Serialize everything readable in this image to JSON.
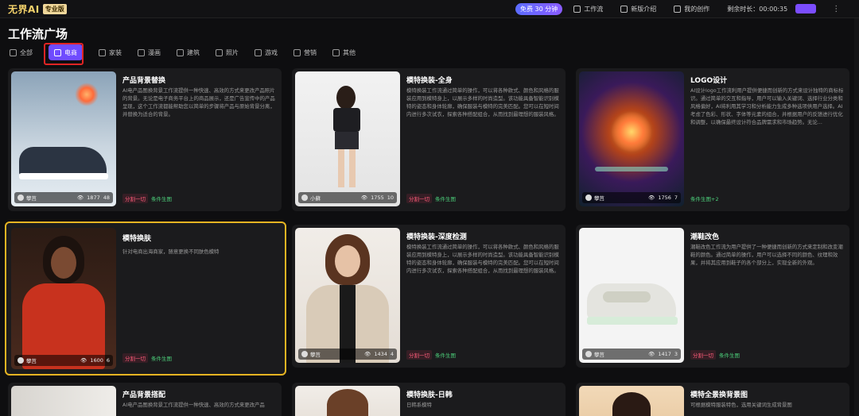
{
  "topbar": {
    "logo": "无界AI",
    "edition": "专业版",
    "free_pill": "免费 30 分钟",
    "nav": [
      {
        "label": "工作流",
        "icon": "workflow-icon"
      },
      {
        "label": "新版介绍",
        "icon": "intro-icon"
      },
      {
        "label": "我的创作",
        "icon": "gallery-icon"
      }
    ],
    "timer": "剩余时长：00:00:35"
  },
  "page": {
    "title": "工作流广场"
  },
  "tabs": [
    {
      "label": "全部",
      "icon": "grid-icon",
      "active": false
    },
    {
      "label": "电商",
      "icon": "shop-icon",
      "active": true
    },
    {
      "label": "家装",
      "icon": "sofa-icon",
      "active": false
    },
    {
      "label": "漫画",
      "icon": "comic-icon",
      "active": false
    },
    {
      "label": "建筑",
      "icon": "building-icon",
      "active": false
    },
    {
      "label": "照片",
      "icon": "camera-icon",
      "active": false
    },
    {
      "label": "游戏",
      "icon": "gamepad-icon",
      "active": false
    },
    {
      "label": "营销",
      "icon": "target-icon",
      "active": false
    },
    {
      "label": "其他",
      "icon": "more-icon",
      "active": false
    }
  ],
  "cards": [
    {
      "title": "产品背景替换",
      "desc": "AI电产品图换背景工作流提供一种快速、高效的方式来更改产品照片的背景。无论是电子商务平台上的商品展示，还是广告宣传中的产品呈现，这个工作流都能帮助您以简单的步骤将产品与原始背景分离，并替换为适合的背景。",
      "author": "攀莒",
      "views": "1877",
      "likes": "48",
      "tags": [
        "分割一切",
        "条件生图"
      ]
    },
    {
      "title": "模特换装-全身",
      "desc": "模特换装工作流通过简单的操作，可以将各种款式、颜色和风格的服装应用到模特身上，以展示多样的时尚造型。该功能具备智能识别模特的姿态和身体轮廓，确保服装与模特的完美匹配。您可以在短时间内进行多次试衣，探索各种搭配组合，从而找到最理想的服装风格。",
      "author": "小蘇",
      "views": "1755",
      "likes": "10",
      "tags": [
        "分割一切",
        "条件生图"
      ]
    },
    {
      "title": "LOGO设计",
      "desc": "AI设计logo工作流利用户提供便捷而创新的方式来设计独特的商标标识。通过简单的交互和指导，用户可以输入关键词、选择行业分类和风格偏好，AI将利用其学习和分析能力生成多种选项供用户选择。AI考虑了色彩、形状、字体等元素的组合，并根据用户的反馈进行优化和调整，以确保最终设计符合品牌需求和市场趋势。无论...",
      "author": "攀莒",
      "views": "1756",
      "likes": "7",
      "tags": [
        "条件生图+2"
      ]
    },
    {
      "title": "模特换肤",
      "desc": "针对电商出海商家，随意更换不同肤色模特",
      "author": "攀莒",
      "views": "1600",
      "likes": "6",
      "tags": [
        "分割一切",
        "条件生图"
      ]
    },
    {
      "title": "模特换装-深度检测",
      "desc": "模特换装工作流通过简单的操作，可以将各种款式、颜色和风格的服装应用到模特身上，以展示多样的时尚造型。该功能具备智能识别模特的姿态和身体轮廓，确保服装与模特的完美匹配。您可以在短时间内进行多次试衣，探索各种搭配组合，从而找到最理想的服装风格。",
      "author": "攀莒",
      "views": "1434",
      "likes": "4",
      "tags": [
        "分割一切",
        "条件生图"
      ]
    },
    {
      "title": "潮鞋改色",
      "desc": "潮鞋改色工作流为用户提供了一种便捷而创新的方式来定制和改变潮鞋的颜色。通过简单的操作，用户可以选择不同的颜色、纹理和效果，并将其应用到鞋子的各个部分上，实现全新的外观。",
      "author": "攀莒",
      "views": "1417",
      "likes": "3",
      "tags": [
        "分割一切",
        "条件生图"
      ]
    },
    {
      "title": "产品背景搭配",
      "desc": "AI电产品图换背景工作流提供一种快速、高效的方式来更改产品",
      "author": "",
      "views": "",
      "likes": "",
      "tags": []
    },
    {
      "title": "模特换肤-日韩",
      "desc": "日韩系模特",
      "author": "",
      "views": "",
      "likes": "",
      "tags": []
    },
    {
      "title": "模特全景换背景图",
      "desc": "可根据模特服装特色，选用关键词生成背景图",
      "author": "",
      "views": "",
      "likes": "",
      "tags": []
    }
  ],
  "colors": {
    "accent": "#6f4cff",
    "highlight_red": "#e02424",
    "selected_gold": "#e6b422",
    "tag_red": "#ff5c7a",
    "tag_green": "#4ccf7a"
  }
}
